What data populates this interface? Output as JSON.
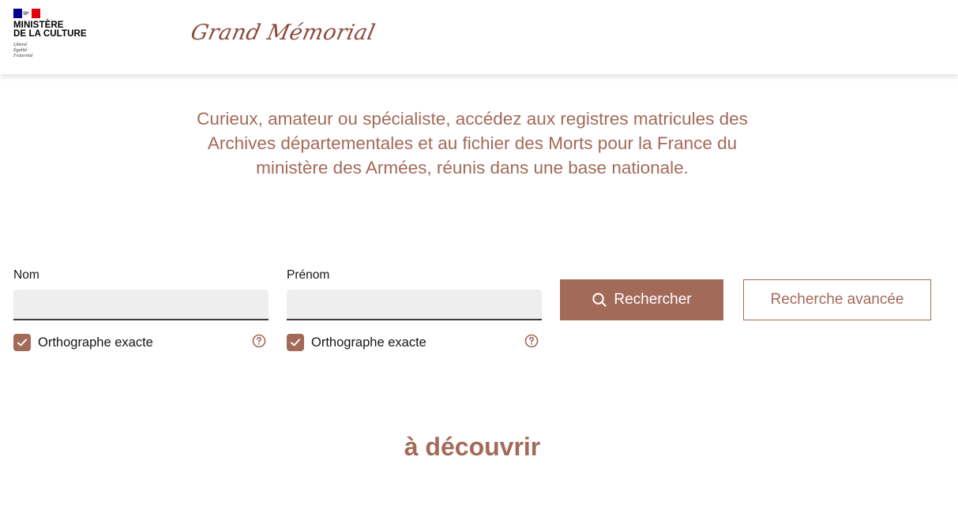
{
  "header": {
    "ministry_line1": "MINISTÈRE",
    "ministry_line2": "DE LA CULTURE",
    "motto_1": "Liberté",
    "motto_2": "Égalité",
    "motto_3": "Fraternité",
    "brand": "Grand Mémorial"
  },
  "intro": {
    "text": "Curieux, amateur ou spécialiste, accédez aux registres matricules des Archives départementales et au fichier des Morts pour la France du ministère des Armées, réunis dans une base nationale."
  },
  "search": {
    "nom": {
      "label": "Nom",
      "value": "",
      "exact_label": "Orthographe exacte",
      "exact_checked": true
    },
    "prenom": {
      "label": "Prénom",
      "value": "",
      "exact_label": "Orthographe exacte",
      "exact_checked": true
    },
    "search_button": "Rechercher",
    "advanced_button": "Recherche avancée"
  },
  "discover": {
    "title": "à découvrir"
  },
  "colors": {
    "accent": "#a36a59",
    "brand": "#8a4a3a",
    "flag_blue": "#000091",
    "flag_red": "#e1000f"
  },
  "icons": {
    "search": "search-icon",
    "help": "help-circle-icon",
    "check": "check-icon",
    "logo": "marianne-flag-icon"
  }
}
